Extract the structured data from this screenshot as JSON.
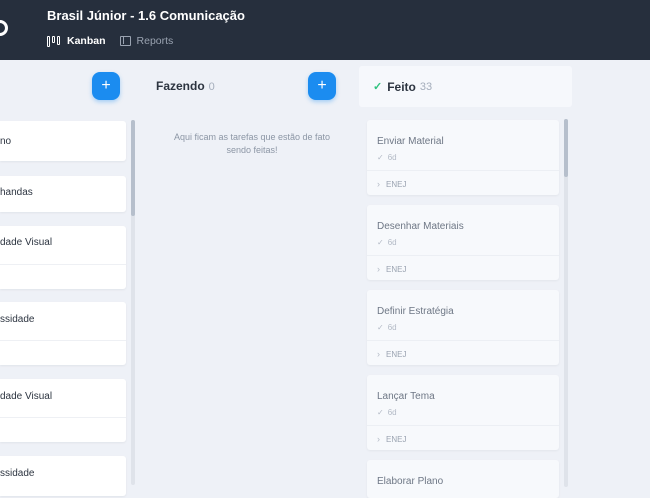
{
  "header": {
    "title": "Brasil Júnior - 1.6 Comunicação",
    "nav": {
      "kanban_label": "Kanban",
      "reports_label": "Reports"
    }
  },
  "columns": {
    "left": {
      "add_label": "+",
      "cards": [
        {
          "title": "no"
        },
        {
          "title": "handas"
        },
        {
          "title": "dade Visual"
        },
        {
          "title": "ssidade"
        },
        {
          "title": "dade Visual"
        },
        {
          "title": "ssidade"
        }
      ]
    },
    "fazendo": {
      "title": "Fazendo",
      "count": "0",
      "add_label": "+",
      "empty_message": "Aqui ficam as tarefas que estão de fato sendo feitas!"
    },
    "feito": {
      "check_icon": "✓",
      "title": "Feito",
      "count": "33",
      "cards": [
        {
          "title": "Enviar Material",
          "age": "6d",
          "project": "ENEJ"
        },
        {
          "title": "Desenhar Materiais",
          "age": "6d",
          "project": "ENEJ"
        },
        {
          "title": "Definir Estratégia",
          "age": "6d",
          "project": "ENEJ"
        },
        {
          "title": "Lançar Tema",
          "age": "6d",
          "project": "ENEJ"
        },
        {
          "title": "Elaborar Plano"
        }
      ]
    }
  },
  "colors": {
    "header_bg": "#262f3d",
    "accent": "#1b8cf0",
    "done_check": "#2ec27e"
  }
}
